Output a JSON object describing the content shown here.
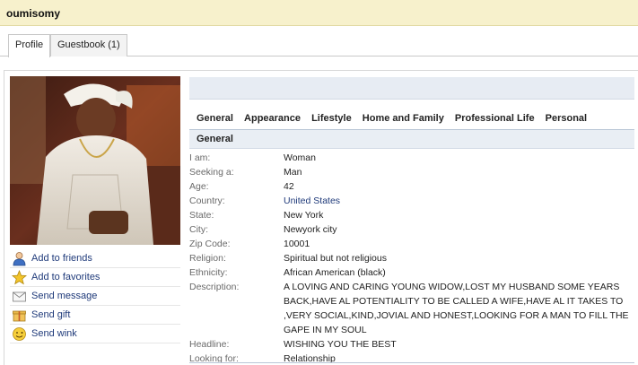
{
  "header": {
    "username": "oumisomy"
  },
  "tabs": [
    {
      "label": "Profile"
    },
    {
      "label": "Guestbook (1)"
    }
  ],
  "actions": [
    {
      "label": "Add to friends",
      "icon": "add-friend-icon"
    },
    {
      "label": "Add to favorites",
      "icon": "star-icon"
    },
    {
      "label": "Send message",
      "icon": "envelope-icon"
    },
    {
      "label": "Send gift",
      "icon": "gift-icon"
    },
    {
      "label": "Send wink",
      "icon": "wink-smiley-icon"
    }
  ],
  "subnav": [
    "General",
    "Appearance",
    "Lifestyle",
    "Home and Family",
    "Professional Life",
    "Personal"
  ],
  "section": {
    "title": "General"
  },
  "fields": [
    {
      "label": "I am:",
      "value": "Woman"
    },
    {
      "label": "Seeking a:",
      "value": "Man"
    },
    {
      "label": "Age:",
      "value": "42"
    },
    {
      "label": "Country:",
      "value": "United States"
    },
    {
      "label": "State:",
      "value": "New York"
    },
    {
      "label": "City:",
      "value": "Newyork city"
    },
    {
      "label": "Zip Code:",
      "value": "10001"
    },
    {
      "label": "Religion:",
      "value": "Spiritual but not religious"
    },
    {
      "label": "Ethnicity:",
      "value": "African American (black)"
    },
    {
      "label": "Description:",
      "value": "A LOVING AND CARING YOUNG WIDOW,LOST MY HUSBAND SOME YEARS BACK,HAVE AL POTENTIALITY TO BE CALLED A WIFE,HAVE AL IT TAKES TO ,VERY SOCIAL,KIND,JOVIAL AND HONEST,LOOKING FOR A MAN TO FILL THE GAPE IN MY SOUL"
    },
    {
      "label": "Headline:",
      "value": "WISHING YOU THE BEST"
    },
    {
      "label": "Looking for:",
      "value": "Relationship"
    }
  ],
  "colors": {
    "header_bg": "#f7f1cc",
    "link": "#1f3a7a",
    "section_bg": "#e9eef4"
  }
}
